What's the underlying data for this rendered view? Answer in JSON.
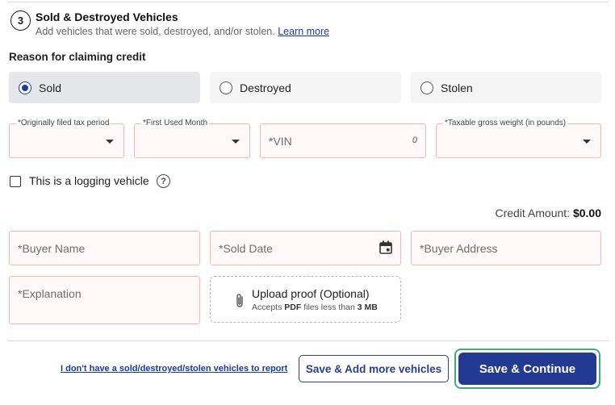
{
  "section": {
    "step_number": "3",
    "title": "Sold & Destroyed Vehicles",
    "subtitle": "Add vehicles that were sold, destroyed, and/or stolen.",
    "learn_more": "Learn more"
  },
  "reason": {
    "label": "Reason for claiming credit",
    "options": [
      {
        "label": "Sold",
        "selected": true
      },
      {
        "label": "Destroyed",
        "selected": false
      },
      {
        "label": "Stolen",
        "selected": false
      }
    ]
  },
  "vehicle_fields": {
    "tax_period_label": "*Originally filed tax period",
    "first_used_label": "*First Used Month",
    "vin_placeholder": "*VIN",
    "vin_count": "0",
    "weight_label": "*Taxable gross weight (in pounds)"
  },
  "logging": {
    "label": "This is a logging vehicle",
    "checked": false,
    "help_glyph": "?"
  },
  "credit": {
    "label": "Credit Amount:",
    "value": "$0.00"
  },
  "buyer_fields": {
    "buyer_name_placeholder": "*Buyer Name",
    "sold_date_placeholder": "*Sold Date",
    "buyer_address_placeholder": "*Buyer Address",
    "explanation_placeholder": "*Explanation"
  },
  "upload": {
    "title": "Upload proof (Optional)",
    "sub_prefix": "Accepts ",
    "sub_format": "PDF",
    "sub_middle": " files less than ",
    "sub_size": "3 MB"
  },
  "footer": {
    "no_vehicles_link": "I don't have a sold/destroyed/stolen vehicles to report",
    "save_add_more": "Save & Add more vehicles",
    "save_continue": "Save & Continue"
  },
  "colors": {
    "primary": "#233a93",
    "focus_ring": "#3fae7a",
    "field_border": "#f2b8b5",
    "link": "#1a3aa8"
  },
  "icons": [
    "calendar-icon",
    "paperclip-icon",
    "help-icon",
    "chevron-down-icon"
  ]
}
